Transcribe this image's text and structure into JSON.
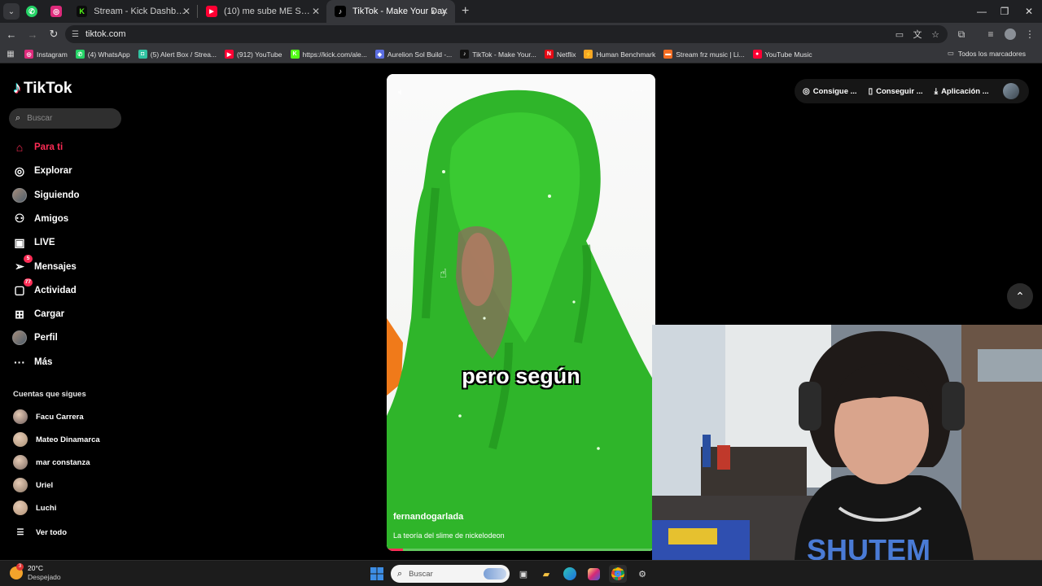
{
  "browser": {
    "tabs": [
      {
        "title": "Stream - Kick Dashboard",
        "favicon": "K",
        "color": "#53fc18"
      },
      {
        "title": "(10) me sube ME SUBE - YouTu",
        "favicon": "▶",
        "color": "#ff0033"
      },
      {
        "title": "TikTok - Make Your Day",
        "favicon": "♪",
        "color": "#000000",
        "active": true
      }
    ],
    "url": "tiktok.com",
    "bookmarks": [
      {
        "label": "Instagram",
        "color": "#dd2a7b",
        "icon": "◎"
      },
      {
        "label": "(4) WhatsApp",
        "color": "#25d366",
        "icon": "✆"
      },
      {
        "label": "(5) Alert Box / Strea...",
        "color": "#31c3a2",
        "icon": "◘"
      },
      {
        "label": "(912) YouTube",
        "color": "#ff0033",
        "icon": "▶"
      },
      {
        "label": "https://kick.com/ale...",
        "color": "#53fc18",
        "icon": "K"
      },
      {
        "label": "Aurelion Sol Build -...",
        "color": "#5b6ee1",
        "icon": "◆"
      },
      {
        "label": "TikTok - Make Your...",
        "color": "#111111",
        "icon": "♪"
      },
      {
        "label": "Netflix",
        "color": "#e50914",
        "icon": "N"
      },
      {
        "label": "Human Benchmark",
        "color": "#f5a623",
        "icon": "⚡"
      },
      {
        "label": "Stream frz music | Li...",
        "color": "#f36c21",
        "icon": "▬"
      },
      {
        "label": "YouTube Music",
        "color": "#ff0033",
        "icon": "●"
      }
    ],
    "all_bookmarks": "Todos los marcadores"
  },
  "tiktok": {
    "logo": "TikTok",
    "search_placeholder": "Buscar",
    "nav": [
      {
        "label": "Para ti",
        "icon": "home-icon",
        "active": true
      },
      {
        "label": "Explorar",
        "icon": "compass-icon"
      },
      {
        "label": "Siguiendo",
        "icon": "following-icon"
      },
      {
        "label": "Amigos",
        "icon": "friends-icon"
      },
      {
        "label": "LIVE",
        "icon": "live-icon"
      },
      {
        "label": "Mensajes",
        "icon": "messages-icon",
        "badge": "5"
      },
      {
        "label": "Actividad",
        "icon": "activity-icon",
        "badge": "77"
      },
      {
        "label": "Cargar",
        "icon": "upload-icon"
      },
      {
        "label": "Perfil",
        "icon": "profile-icon"
      },
      {
        "label": "Más",
        "icon": "more-icon"
      }
    ],
    "following_title": "Cuentas que sigues",
    "following": [
      {
        "name": "Facu Carrera",
        "color": "#6b5a5a"
      },
      {
        "name": "Mateo Dinamarca",
        "color": "#a88f74"
      },
      {
        "name": "mar constanza",
        "color": "#7c6a62"
      },
      {
        "name": "Uriel",
        "color": "#8a7665"
      },
      {
        "name": "Luchi",
        "color": "#b09175"
      }
    ],
    "see_all": "Ver todo",
    "top_actions": [
      "Consigue ...",
      "Conseguir ...",
      "Aplicación ..."
    ],
    "video": {
      "caption": "pero según",
      "author": "fernandogarlada",
      "description": "La teoría del slime de nickelodeon",
      "progress": 0.06
    }
  },
  "taskbar": {
    "temperature": "20°C",
    "weather": "Despejado",
    "weather_badge": "3",
    "search_placeholder": "Buscar"
  }
}
